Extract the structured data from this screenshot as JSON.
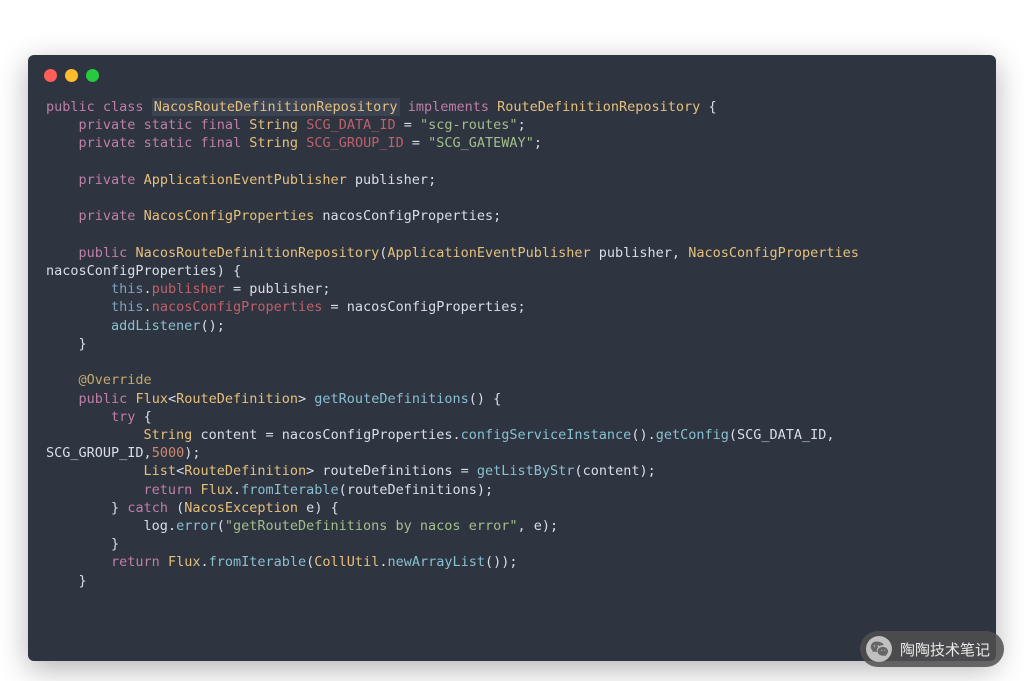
{
  "code": {
    "className": "NacosRouteDefinitionRepository",
    "implements": "RouteDefinitionRepository",
    "constDataIdName": "SCG_DATA_ID",
    "constDataIdValue": "\"scg-routes\"",
    "constGroupIdName": "SCG_GROUP_ID",
    "constGroupIdValue": "\"SCG_GATEWAY\"",
    "publisherType": "ApplicationEventPublisher",
    "publisherName": "publisher",
    "configPropsType": "NacosConfigProperties",
    "configPropsName": "nacosConfigProperties",
    "addListenerCall": "addListener",
    "override": "@Override",
    "fluxType": "Flux",
    "routeDefType": "RouteDefinition",
    "getRouteDefs": "getRouteDefinitions",
    "contentVar": "content",
    "configServiceInstance": "configServiceInstance",
    "getConfig": "getConfig",
    "timeout": "5000",
    "listType": "List",
    "routeDefsVar": "routeDefinitions",
    "getListByStr": "getListByStr",
    "fromIterable": "fromIterable",
    "exceptionType": "NacosException",
    "exceptionVar": "e",
    "logVar": "log",
    "errorFn": "error",
    "errorMsg": "\"getRouteDefinitions by nacos error\"",
    "collUtil": "CollUtil",
    "newArrayList": "newArrayList",
    "kw_public": "public",
    "kw_class": "class",
    "kw_implements": "implements",
    "kw_private": "private",
    "kw_static": "static",
    "kw_final": "final",
    "kw_this": "this",
    "kw_try": "try",
    "kw_catch": "catch",
    "kw_return": "return",
    "type_String": "String"
  },
  "wechat": {
    "label": "陶陶技术笔记"
  }
}
